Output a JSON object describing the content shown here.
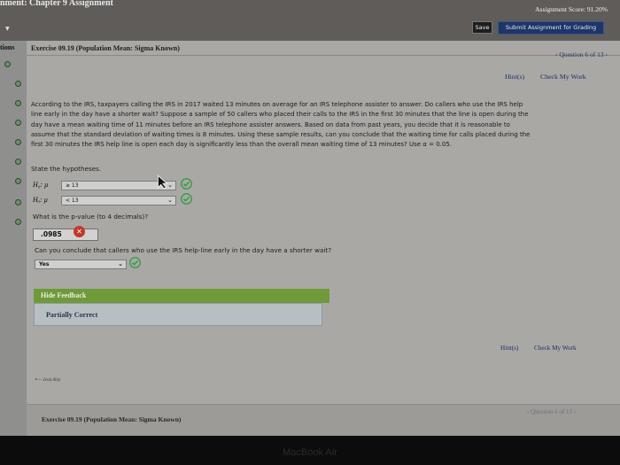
{
  "topbar": {
    "course_title": "nment: Chapter 9 Assignment",
    "score": "Assignment Score: 91.20%",
    "save_label": "Save",
    "submit_label": "Submit Assignment for Grading"
  },
  "left_rail": {
    "tab_label": "tions",
    "dot_count": 9
  },
  "exercise": {
    "title": "Exercise 09.19 (Population Mean: Sigma Known)",
    "question_nav": "‹ Question 6 of 13 ›",
    "hints_label": "Hint(s)",
    "check_label": "Check My Work"
  },
  "problem": {
    "line1": "According to the IRS, taxpayers calling the IRS in 2017 waited 13 minutes on average for an IRS telephone assister to answer. Do callers who use the IRS help",
    "line2": "line early in the day have a shorter wait? Suppose a sample of 50 callers who placed their calls to the IRS in the first 30 minutes that the line is open during the",
    "line3": "day have a mean waiting time of 11 minutes before an IRS telephone assister answers. Based on data from past years, you decide that it is reasonable to",
    "line4": "assume that the standard deviation of waiting times is 8 minutes. Using these sample results, can you conclude that the waiting time for calls placed during the",
    "line5": "first 30 minutes the IRS help line is open each day is significantly less than the overall mean waiting time of 13 minutes? Use α = 0.05."
  },
  "hypotheses": {
    "prompt": "State the hypotheses.",
    "h0_label": "H₀: μ",
    "h0_value": "≥ 13",
    "ha_label": "Hₐ: μ",
    "ha_value": "< 13"
  },
  "pvalue": {
    "prompt": "What is the p-value (to 4 decimals)?",
    "value": ".0985"
  },
  "conclusion": {
    "prompt": "Can you conclude that callers who use the IRS help-line early in the day have a shorter wait?",
    "value": "Yes"
  },
  "feedback": {
    "header": "Hide Feedback",
    "result": "Partially Correct"
  },
  "footer": {
    "hints_label": "Hint(s)",
    "check_label": "Check My Work",
    "icon_key": "Icon Key",
    "bottom_title": "Exercise 09.19 (Population Mean: Sigma Known)",
    "bottom_qnav": "‹ Question 6 of 13 ›"
  },
  "bezel": {
    "logo": "MacBook Air"
  },
  "colors": {
    "correct": "#2e9e3a",
    "incorrect": "#c0392b",
    "feedback_green": "#6f9a39",
    "submit_blue": "#1d3568"
  }
}
